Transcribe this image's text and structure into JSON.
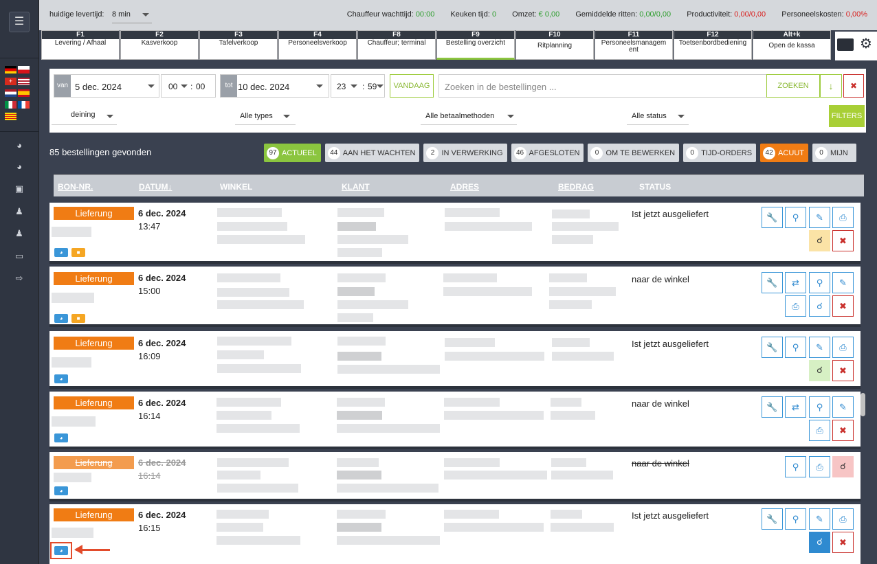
{
  "topbar": {
    "lead_label": "huidige levertijd:",
    "lead_value": "8 min",
    "stats": [
      {
        "label": "Chauffeur wachttijd:",
        "value": "00:00",
        "color": "green"
      },
      {
        "label": "Keuken tijd:",
        "value": "0",
        "color": "green"
      },
      {
        "label": "Omzet:",
        "value": "€ 0,00",
        "color": "green"
      },
      {
        "label": "Gemiddelde ritten:",
        "value": "0,00/0,00",
        "color": "green"
      },
      {
        "label": "Productiviteit:",
        "value": "0,00/0,00",
        "color": "red"
      },
      {
        "label": "Personeelskosten:",
        "value": "0,00%",
        "color": "red"
      }
    ]
  },
  "fkeys": [
    {
      "key": "F1",
      "label": "Levering / Afhaal"
    },
    {
      "key": "F2",
      "label": "Kasverkoop"
    },
    {
      "key": "F3",
      "label": "Tafelverkoop"
    },
    {
      "key": "F4",
      "label": "Personeelsverkoop"
    },
    {
      "key": "F8",
      "label": "Chauffeur; terminal"
    },
    {
      "key": "F9",
      "label": "Bestelling overzicht"
    },
    {
      "key": "F10",
      "label": "Ritplanning"
    },
    {
      "key": "F11",
      "label": "Personeelsmanagem ent"
    },
    {
      "key": "F12",
      "label": "Toetsenbordbediening"
    },
    {
      "key": "Alt+k",
      "label": "Open de kassa"
    }
  ],
  "filters": {
    "from_tag": "van",
    "from_date": "5 dec. 2024",
    "from_hour": "00",
    "from_min": "00",
    "to_tag": "tot",
    "to_date": "10 dec. 2024",
    "to_hour": "23",
    "to_min": "59",
    "today_label": "VANDAAG",
    "search_placeholder": "Zoeken in de bestellingen ...",
    "search_button": "ZOEKEN",
    "select_1": "deining",
    "select_2": "Alle types",
    "select_3": "Alle betaalmethoden",
    "select_4": "Alle status",
    "filters_button": "FILTERS"
  },
  "found_text": "85 bestellingen gevonden",
  "pills": [
    {
      "count": "97",
      "label": "ACTUEEL",
      "style": "green"
    },
    {
      "count": "44",
      "label": "AAN HET WACHTEN",
      "style": ""
    },
    {
      "count": "2",
      "label": "IN VERWERKING",
      "style": ""
    },
    {
      "count": "46",
      "label": "AFGESLOTEN",
      "style": ""
    },
    {
      "count": "0",
      "label": "OM TE BEWERKEN",
      "style": ""
    },
    {
      "count": "0",
      "label": "TIJD-ORDERS",
      "style": ""
    },
    {
      "count": "42",
      "label": "ACUUT",
      "style": "orange"
    },
    {
      "count": "0",
      "label": "MIJN",
      "style": ""
    }
  ],
  "table": {
    "headers": {
      "bon": "BON-NR.",
      "datum": "DATUM",
      "winkel": "WINKEL",
      "klant": "KLANT",
      "adres": "ADRES",
      "bedrag": "BEDRAG",
      "status": "STATUS"
    },
    "rows": [
      {
        "type": "Lieferung",
        "date": "6 dec. 2024",
        "time": "13:47",
        "status": "Ist jetzt ausgeliefert"
      },
      {
        "type": "Lieferung",
        "date": "6 dec. 2024",
        "time": "15:00",
        "status": "naar de winkel"
      },
      {
        "type": "Lieferung",
        "date": "6 dec. 2024",
        "time": "16:09",
        "status": "Ist jetzt ausgeliefert"
      },
      {
        "type": "Lieferung",
        "date": "6 dec. 2024",
        "time": "16:14",
        "status": "naar de winkel"
      },
      {
        "type": "Lieferung",
        "date": "6 dec. 2024",
        "time": "16:14",
        "status": "naar de winkel"
      },
      {
        "type": "Lieferung",
        "date": "6 dec. 2024",
        "time": "16:15",
        "status": "Ist jetzt ausgeliefert"
      }
    ]
  }
}
